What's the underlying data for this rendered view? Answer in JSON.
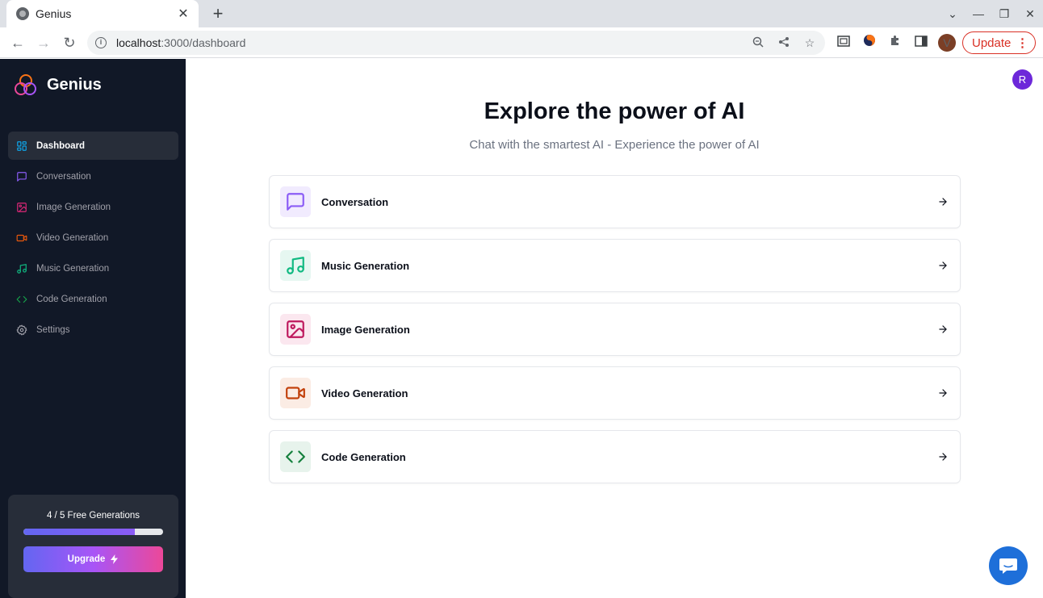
{
  "browser": {
    "tab_title": "Genius",
    "url_host": "localhost",
    "url_path": ":3000/dashboard",
    "update_label": "Update",
    "profile_initial": "V"
  },
  "sidebar": {
    "brand": "Genius",
    "items": [
      {
        "label": "Dashboard",
        "icon": "layout-dashboard-icon",
        "color": "#0ea5e9",
        "active": true
      },
      {
        "label": "Conversation",
        "icon": "message-square-icon",
        "color": "#8b5cf6"
      },
      {
        "label": "Image Generation",
        "icon": "image-icon",
        "color": "#db2777"
      },
      {
        "label": "Video Generation",
        "icon": "video-icon",
        "color": "#ea580c"
      },
      {
        "label": "Music Generation",
        "icon": "music-icon",
        "color": "#10b981"
      },
      {
        "label": "Code Generation",
        "icon": "code-icon",
        "color": "#16a34a"
      },
      {
        "label": "Settings",
        "icon": "settings-icon",
        "color": "#a1a1aa"
      }
    ],
    "free_generations": {
      "text": "4 / 5 Free Generations",
      "used": 4,
      "limit": 5
    },
    "upgrade_label": "Upgrade"
  },
  "main": {
    "avatar_initial": "R",
    "title": "Explore the power of AI",
    "subtitle": "Chat with the smartest AI - Experience the power of AI",
    "tools": [
      {
        "label": "Conversation",
        "icon": "message-square-icon",
        "color": "#8b5cf6",
        "bg": "#f1ebfe"
      },
      {
        "label": "Music Generation",
        "icon": "music-icon",
        "color": "#10b981",
        "bg": "#e6f7f1"
      },
      {
        "label": "Image Generation",
        "icon": "image-icon",
        "color": "#be185d",
        "bg": "#fbe7ef"
      },
      {
        "label": "Video Generation",
        "icon": "video-icon",
        "color": "#c2410c",
        "bg": "#fbece4"
      },
      {
        "label": "Code Generation",
        "icon": "code-icon",
        "color": "#15803d",
        "bg": "#e7f3ec"
      }
    ]
  }
}
